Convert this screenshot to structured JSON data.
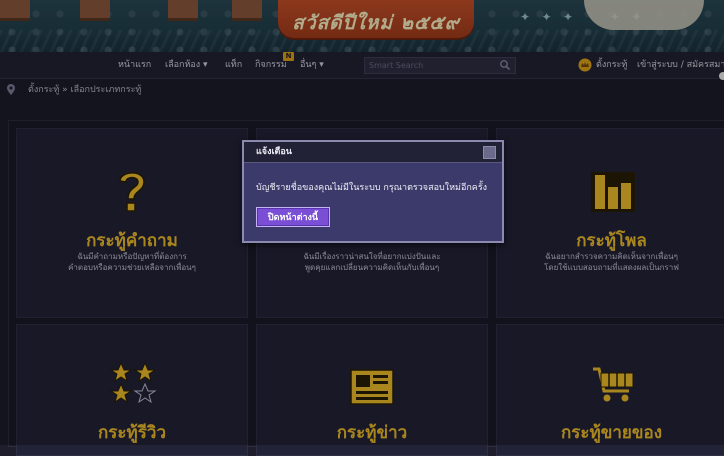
{
  "banner": {
    "greeting": "สวัสดีปีใหม่ ๒๕๕๙"
  },
  "navbar": {
    "home": "หน้าแรก",
    "rooms": "เลือกห้อง ▾",
    "tags": "แท็ก",
    "activities": "กิจกรรม",
    "activities_badge": "N",
    "more": "อื่นๆ ▾",
    "search_placeholder": "Smart Search",
    "post_topic": "ตั้งกระทู้",
    "login": "เข้าสู่ระบบ / สมัครสมาชิก"
  },
  "breadcrumb": {
    "text": "ตั้งกระทู้ » เลือกประเภทกระทู้"
  },
  "cards": {
    "question": {
      "title": "กระทู้คำถาม",
      "desc1": "ฉันมีคำถามหรือปัญหาที่ต้องการ",
      "desc2": "คำตอบหรือความช่วยเหลือจากเพื่อนๆ"
    },
    "chat": {
      "desc1": "ฉันมีเรื่องราวน่าสนใจที่อยากแบ่งปันและ",
      "desc2": "พูดคุยแลกเปลี่ยนความคิดเห็นกับเพื่อนๆ"
    },
    "poll": {
      "title": "กระทู้โพล",
      "desc1": "ฉันอยากสำรวจความคิดเห็นจากเพื่อนๆ",
      "desc2": "โดยใช้แบบสอบถามที่แสดงผลเป็นกราฟ"
    },
    "review": {
      "title": "กระทู้รีวิว"
    },
    "news": {
      "title": "กระทู้ข่าว"
    },
    "sell": {
      "title": "กระทู้ขายของ"
    }
  },
  "modal": {
    "title": "แจ้งเตือน",
    "message": "บัญชีรายชื่อของคุณไม่มีในระบบ กรุณาตรวจสอบใหม่อีกครั้ง",
    "close_button": "ปิดหน้าต่างนี้"
  },
  "colors": {
    "accent_gold": "#f2c12c",
    "modal_button": "#7a4fd6"
  }
}
